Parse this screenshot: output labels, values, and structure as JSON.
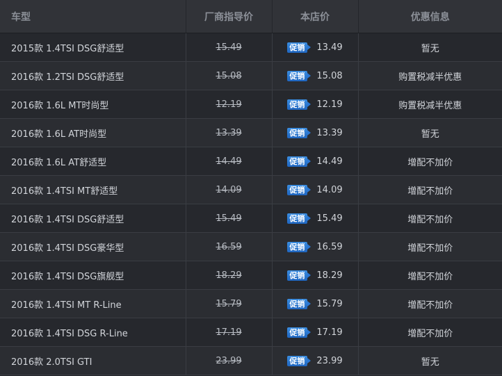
{
  "table": {
    "headers": {
      "model": "车型",
      "msrp": "厂商指导价",
      "store_price": "本店价",
      "promo": "优惠信息"
    },
    "promo_badge": "促销",
    "rows": [
      {
        "model": "2015款 1.4TSI DSG舒适型",
        "msrp": "15.49",
        "price": "13.49",
        "offer": "暂无"
      },
      {
        "model": "2016款 1.2TSI DSG舒适型",
        "msrp": "15.08",
        "price": "15.08",
        "offer": "购置税减半优惠"
      },
      {
        "model": "2016款 1.6L MT时尚型",
        "msrp": "12.19",
        "price": "12.19",
        "offer": "购置税减半优惠"
      },
      {
        "model": "2016款 1.6L AT时尚型",
        "msrp": "13.39",
        "price": "13.39",
        "offer": "暂无"
      },
      {
        "model": "2016款 1.6L AT舒适型",
        "msrp": "14.49",
        "price": "14.49",
        "offer": "增配不加价"
      },
      {
        "model": "2016款 1.4TSI MT舒适型",
        "msrp": "14.09",
        "price": "14.09",
        "offer": "增配不加价"
      },
      {
        "model": "2016款 1.4TSI DSG舒适型",
        "msrp": "15.49",
        "price": "15.49",
        "offer": "增配不加价"
      },
      {
        "model": "2016款 1.4TSI DSG豪华型",
        "msrp": "16.59",
        "price": "16.59",
        "offer": "增配不加价"
      },
      {
        "model": "2016款 1.4TSI DSG旗舰型",
        "msrp": "18.29",
        "price": "18.29",
        "offer": "增配不加价"
      },
      {
        "model": "2016款 1.4TSI MT R-Line",
        "msrp": "15.79",
        "price": "15.79",
        "offer": "增配不加价"
      },
      {
        "model": "2016款 1.4TSI DSG R-Line",
        "msrp": "17.19",
        "price": "17.19",
        "offer": "增配不加价"
      },
      {
        "model": "2016款 2.0TSI GTI",
        "msrp": "23.99",
        "price": "23.99",
        "offer": "暂无"
      }
    ]
  }
}
